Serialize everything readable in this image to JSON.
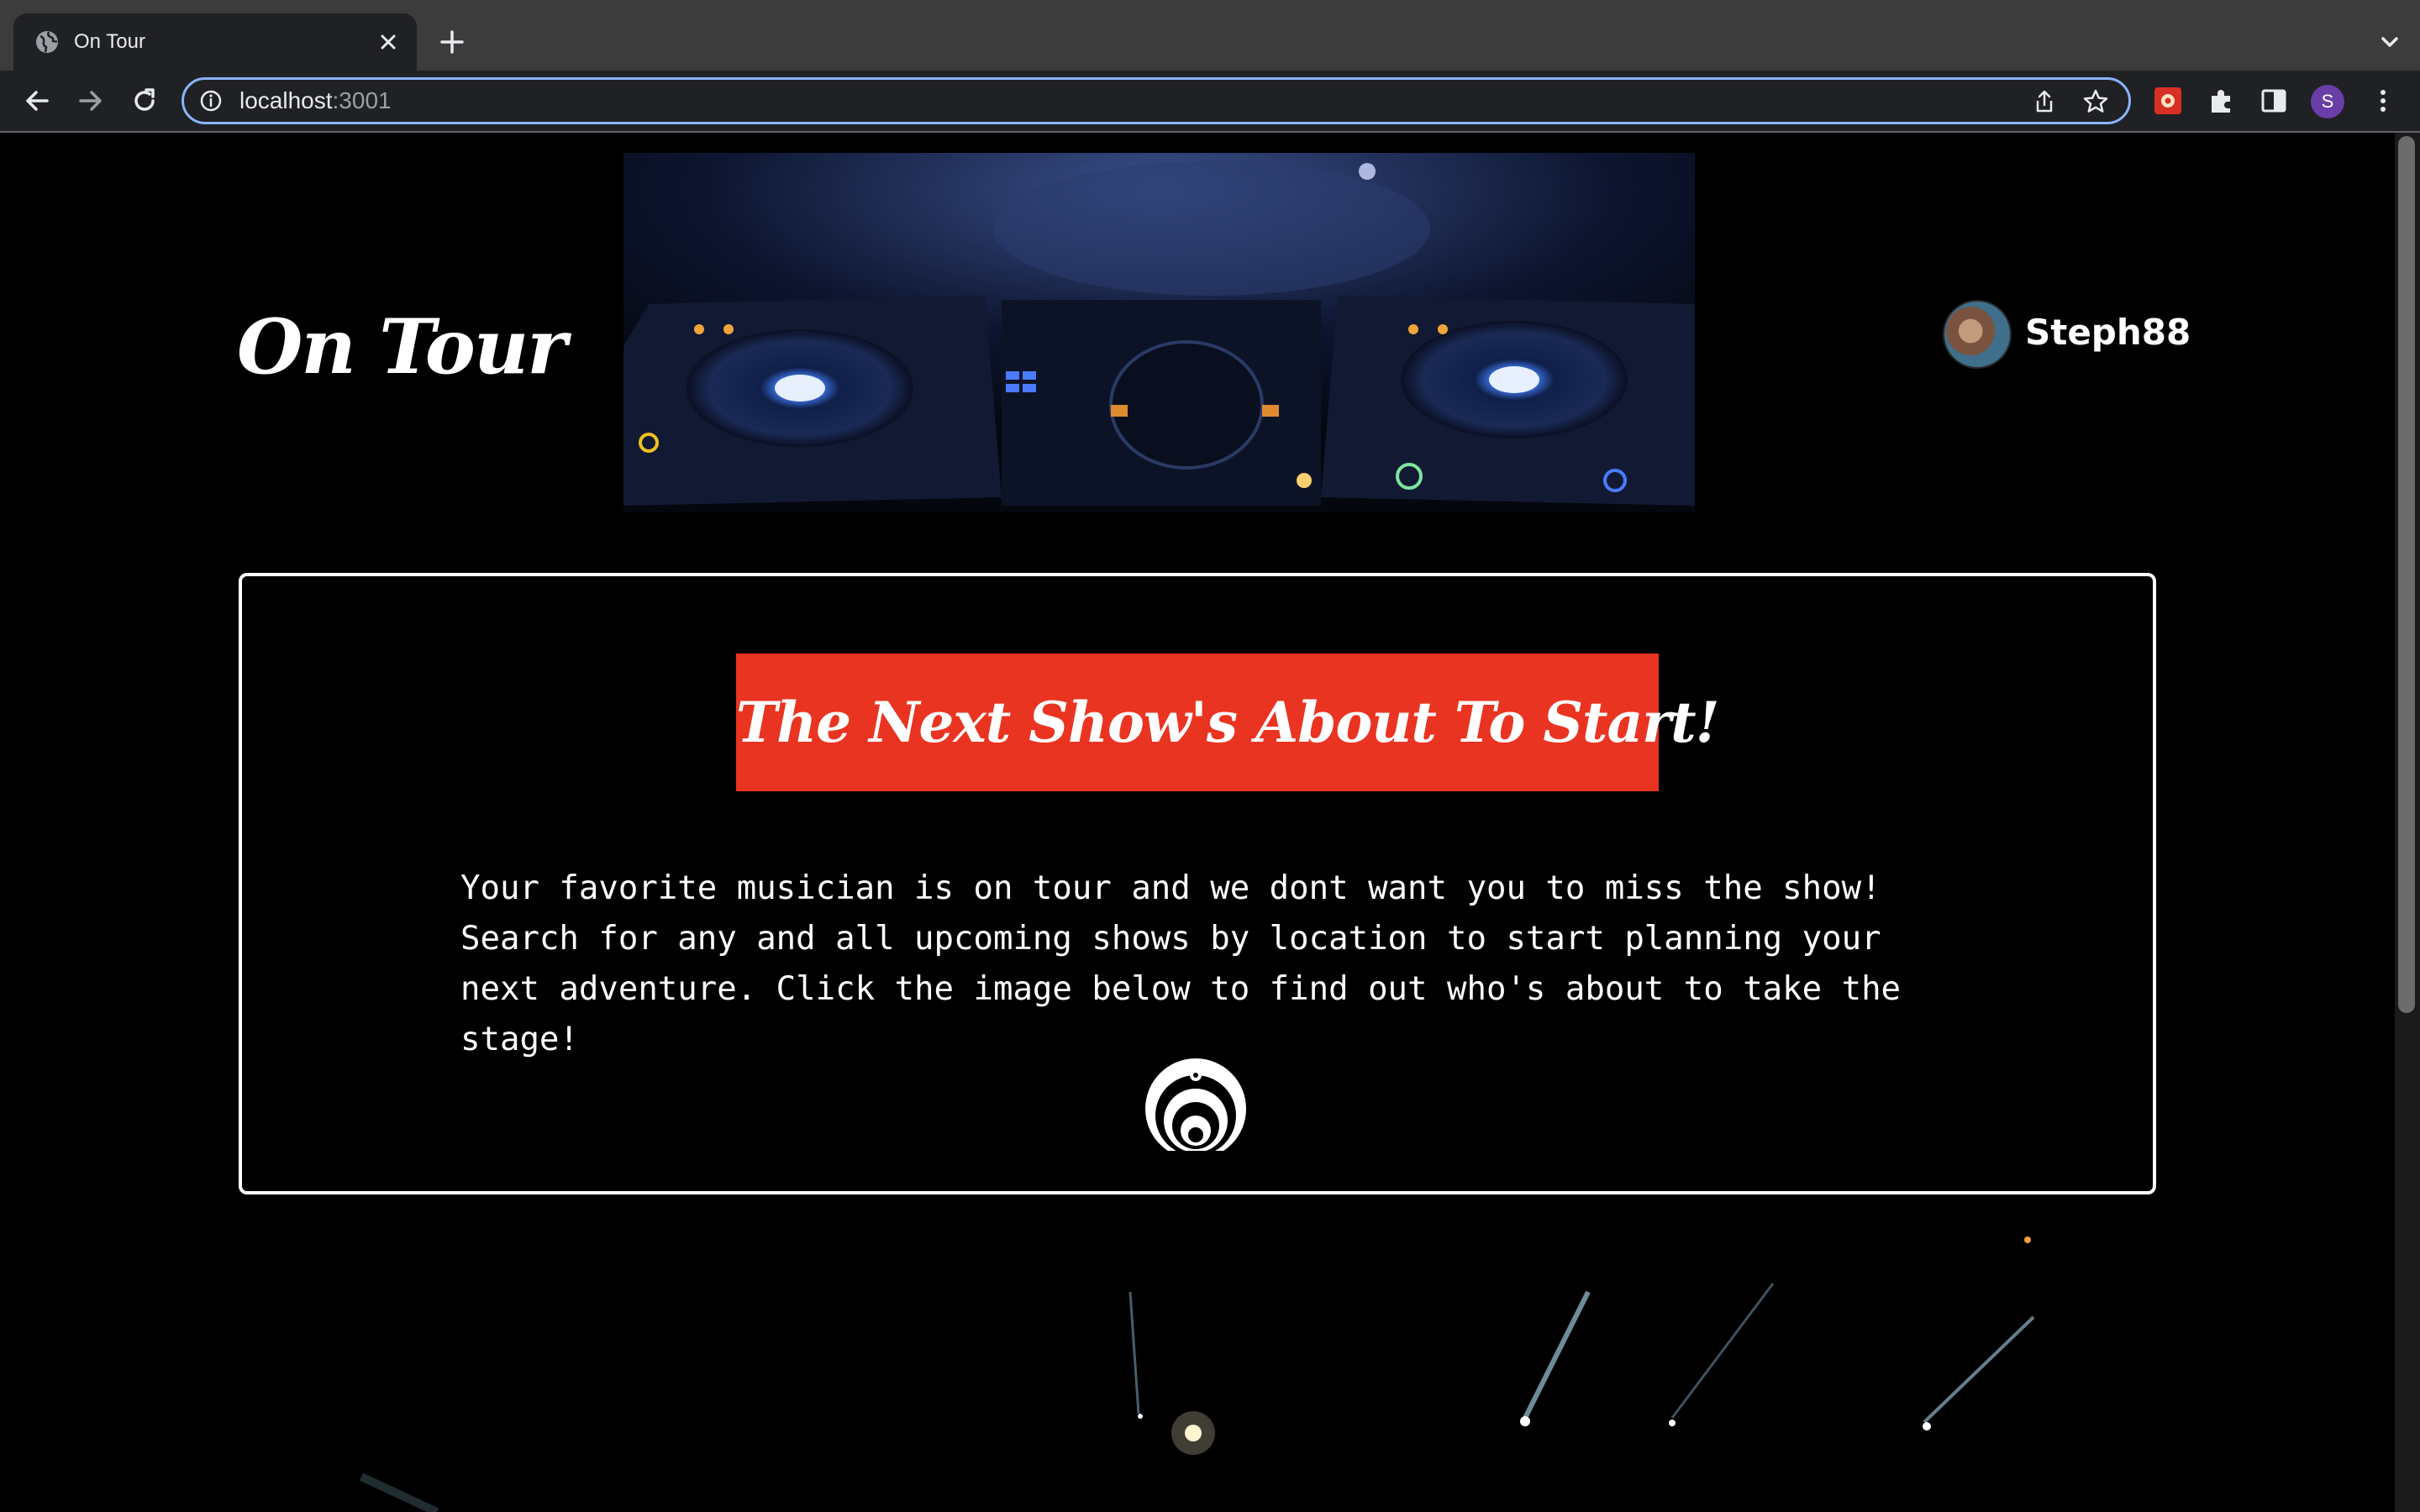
{
  "browser": {
    "tab_title": "On Tour",
    "url_host": "localhost",
    "url_port": ":3001",
    "profile_initial": "S",
    "accent": "#8ab4f8"
  },
  "header": {
    "logo_text": "On Tour",
    "username": "Steph88"
  },
  "main": {
    "cta_title": "The Next Show's About To Start!",
    "cta_color": "#ea3422",
    "intro_text": "Your favorite musician is on tour and we dont want you to miss the show! Search for any and all upcoming shows by location to start planning your next adventure. Click the image below to find out who's about to take the stage!"
  },
  "icons": {
    "tab_favicon": "globe-icon",
    "band_logo": "bassnectar-logo-icon"
  }
}
